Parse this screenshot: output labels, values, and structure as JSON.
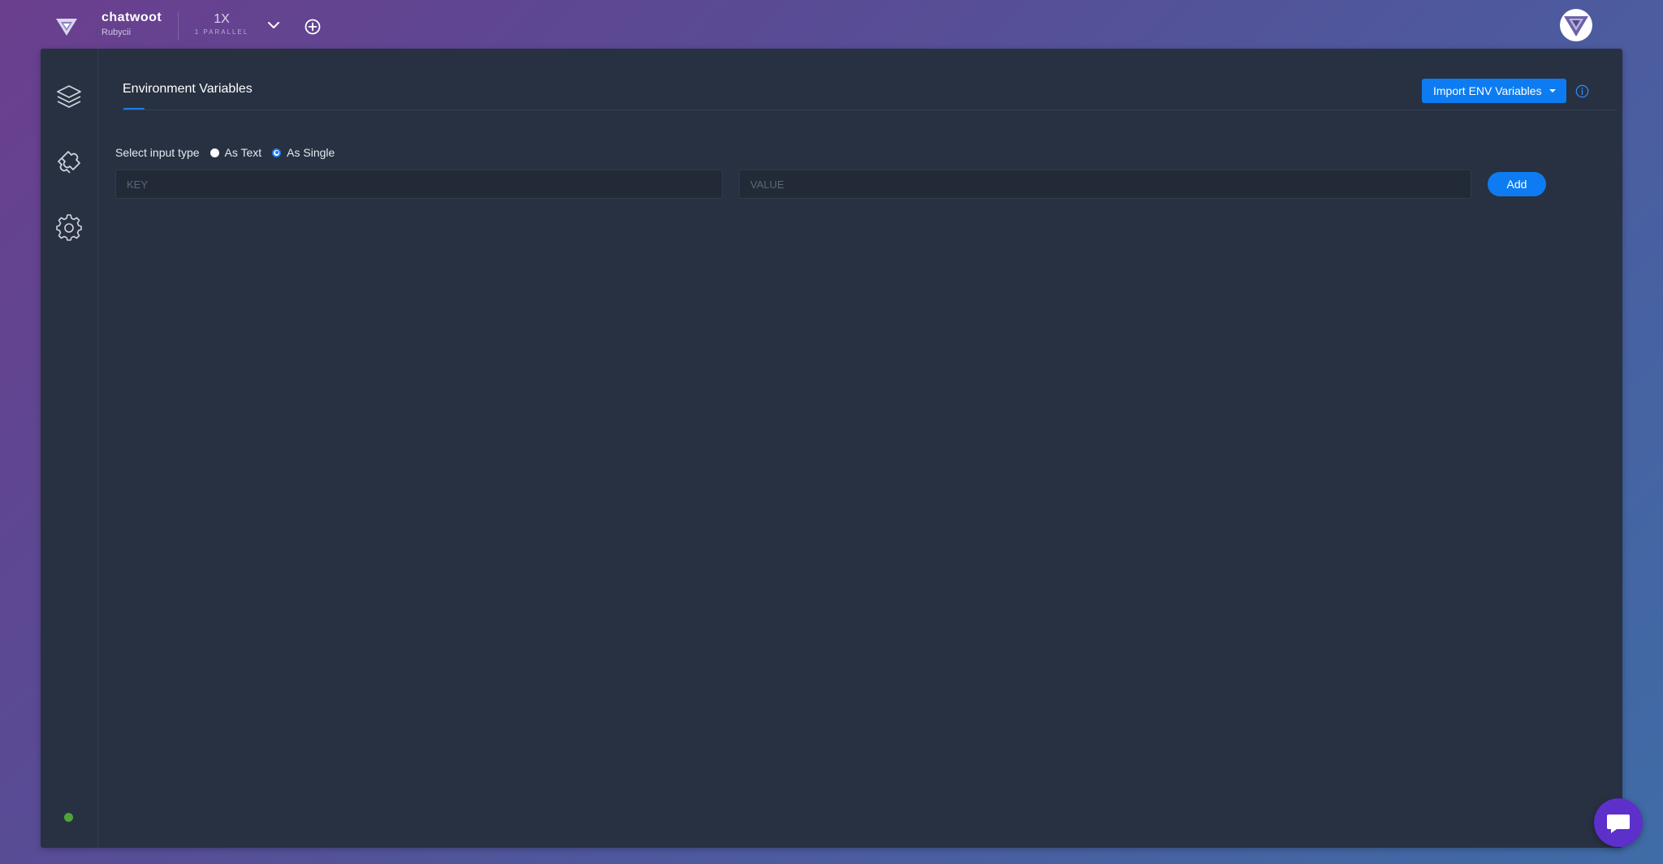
{
  "header": {
    "project_name": "chatwoot",
    "org_name": "Rubycii",
    "parallel_value": "1X",
    "parallel_label": "1 PARALLEL",
    "logo_icon": "triangle-logo-icon",
    "dropdown_icon": "chevron-down-icon",
    "add_icon": "plus-circle-icon",
    "avatar_icon": "triangle-logo-icon"
  },
  "sidebar": {
    "items": [
      {
        "name": "layers-icon"
      },
      {
        "name": "puzzle-icon"
      },
      {
        "name": "gear-icon"
      }
    ],
    "status_color": "#4fa437"
  },
  "main": {
    "tab_label": "Environment Variables",
    "import_button_label": "Import ENV Variables",
    "info_icon": "info-icon",
    "input_type_label": "Select input type",
    "radio_options": [
      {
        "label": "As Text",
        "checked": false
      },
      {
        "label": "As Single",
        "checked": true
      }
    ],
    "key_placeholder": "KEY",
    "key_value": "",
    "value_placeholder": "VALUE",
    "value_value": "",
    "add_button_label": "Add"
  },
  "colors": {
    "accent": "#0d7cf2",
    "panel_bg": "#283142",
    "chat_launcher": "#5d2fcb"
  },
  "chat_icon": "chat-bubble-icon"
}
